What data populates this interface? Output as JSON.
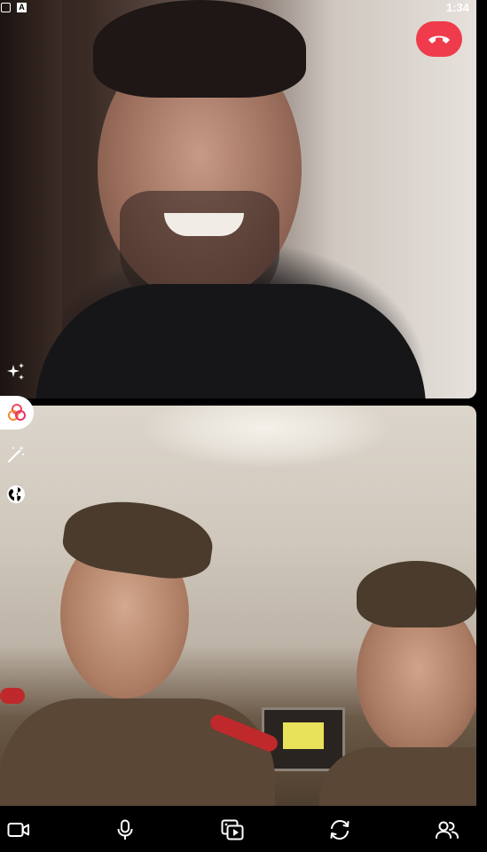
{
  "status_bar": {
    "time": "1:34",
    "left_icons": [
      "screen-icon",
      "a-icon"
    ],
    "a_label": "A"
  },
  "call": {
    "end_call_color": "#ef3b4b",
    "end_call_icon": "phone-hangup-icon"
  },
  "side_toolbar": {
    "icons": [
      "sparkles-icon",
      "lens-icon",
      "magic-wand-icon",
      "globe-icon"
    ]
  },
  "bottom_bar": {
    "icons": [
      "video-camera-icon",
      "microphone-icon",
      "media-share-icon",
      "flip-camera-icon",
      "participants-icon"
    ]
  }
}
